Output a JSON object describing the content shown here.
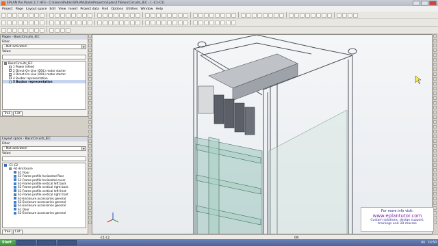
{
  "app": {
    "title": "EPLAN Pro Panel 2.7 HF3 - C:\\Users\\Public\\EPLAN\\Data\\Projects\\Eplan27\\BasicCircuits_IEC - [ -C1-C2]"
  },
  "menu": [
    "Project",
    "Page",
    "Layout space",
    "Edit",
    "View",
    "Insert",
    "Project data",
    "Find",
    "Options",
    "Utilities",
    "Window",
    "Help"
  ],
  "pages_panel": {
    "header": "Pages - BasicCircuits_IEC",
    "filter_label": "Filter:",
    "filter_value": "- Not activated -",
    "value_label": "Value:",
    "tree": [
      {
        "label": "BasicCircuits_IEC",
        "level": 0
      },
      {
        "label": "1 Power infeed",
        "level": 1
      },
      {
        "label": "2 Direct-On-Line (DOL) motor starter",
        "level": 1
      },
      {
        "label": "3 Direct-On-Line (DOL) motor starter",
        "level": 1
      },
      {
        "label": "4 Busbar representation",
        "level": 1
      },
      {
        "label": "5 Busbar representation",
        "level": 1,
        "selected": true
      }
    ],
    "tabs": [
      "Tree",
      "List"
    ]
  },
  "layout_panel": {
    "header": "Layout space - BasicCircuits_IEC",
    "filter_label": "Filter:",
    "filter_value": "- Not activated -",
    "value_label": "Value:",
    "tree": [
      {
        "label": "-C1-C2",
        "level": 0
      },
      {
        "label": "-S1-Enclosure",
        "level": 1
      },
      {
        "label": "S1 Floor",
        "level": 2
      },
      {
        "label": "S1-Frame profile horizontal floor",
        "level": 2
      },
      {
        "label": "S1-Frame profile horizontal cover",
        "level": 2
      },
      {
        "label": "S1-Frame profile vertical left back",
        "level": 2
      },
      {
        "label": "S1-Frame profile vertical right back",
        "level": 2
      },
      {
        "label": "S1-Frame profile vertical left front",
        "level": 2
      },
      {
        "label": "S1-Frame profile vertical right front",
        "level": 2
      },
      {
        "label": "S1-Enclosure accessories general",
        "level": 2
      },
      {
        "label": "S1-Enclosure accessories general",
        "level": 2
      },
      {
        "label": "S1-Enclosure accessories general",
        "level": 2
      },
      {
        "label": "S1 Door",
        "level": 2
      },
      {
        "label": "S1-Enclosure accessories general",
        "level": 2
      }
    ],
    "tabs": [
      "Tree",
      "List"
    ]
  },
  "info_box": {
    "line1": "For more info visit:",
    "link": "www.eplantutor.com",
    "line3": "Custom solutions, design support,",
    "line4": "trainings and 3D macros"
  },
  "status": {
    "coords": "-C1-C2",
    "zoom": "ON",
    "mode": ""
  },
  "taskbar": {
    "start": "Start",
    "lang": "HU",
    "time": "14:50"
  },
  "colors": {
    "cabinet_stroke": "#4a4f58",
    "plate_fill": "#8fbfb3",
    "breaker_fill": "#5a5f68",
    "link": "#7b1fa2"
  }
}
